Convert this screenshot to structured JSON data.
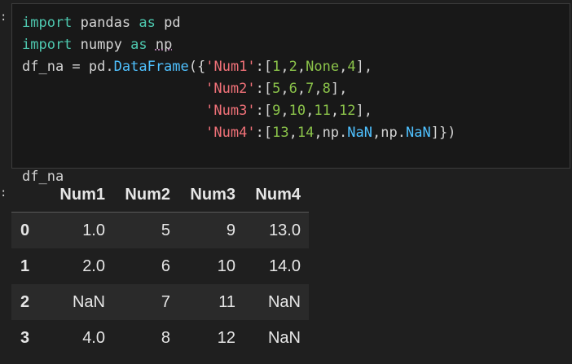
{
  "input_prompt": ":",
  "output_prompt": ":",
  "code": {
    "line1": {
      "kw1": "import",
      "mod": "pandas",
      "kw2": "as",
      "alias": "pd"
    },
    "line2": {
      "kw1": "import",
      "mod": "numpy",
      "kw2": "as",
      "alias": "np"
    },
    "line3": {
      "var": "df_na",
      "eq": " = ",
      "obj": "pd",
      "dot": ".",
      "func": "DataFrame",
      "open": "({",
      "key": "'Num1'",
      "colon": ":",
      "lb": "[",
      "v1": "1",
      "c1": ",",
      "v2": "2",
      "c2": ",",
      "v3": "None",
      "c3": ",",
      "v4": "4",
      "rb": "],"
    },
    "line4": {
      "key": "'Num2'",
      "colon": ":",
      "lb": "[",
      "v1": "5",
      "c1": ",",
      "v2": "6",
      "c2": ",",
      "v3": "7",
      "c3": ",",
      "v4": "8",
      "rb": "],"
    },
    "line5": {
      "key": "'Num3'",
      "colon": ":",
      "lb": "[",
      "v1": "9",
      "c1": ",",
      "v2": "10",
      "c2": ",",
      "v3": "11",
      "c3": ",",
      "v4": "12",
      "rb": "],"
    },
    "line6": {
      "key": "'Num4'",
      "colon": ":",
      "lb": "[",
      "v1": "13",
      "c1": ",",
      "v2": "14",
      "c2": ",",
      "np1": "np",
      "d1": ".",
      "nan1": "NaN",
      "c3": ",",
      "np2": "np",
      "d2": ".",
      "nan2": "NaN",
      "close": "]})"
    },
    "line7": {
      "var": "df_na"
    }
  },
  "table": {
    "columns": [
      "",
      "Num1",
      "Num2",
      "Num3",
      "Num4"
    ],
    "rows": [
      [
        "0",
        "1.0",
        "5",
        "9",
        "13.0"
      ],
      [
        "1",
        "2.0",
        "6",
        "10",
        "14.0"
      ],
      [
        "2",
        "NaN",
        "7",
        "11",
        "NaN"
      ],
      [
        "3",
        "4.0",
        "8",
        "12",
        "NaN"
      ]
    ]
  }
}
